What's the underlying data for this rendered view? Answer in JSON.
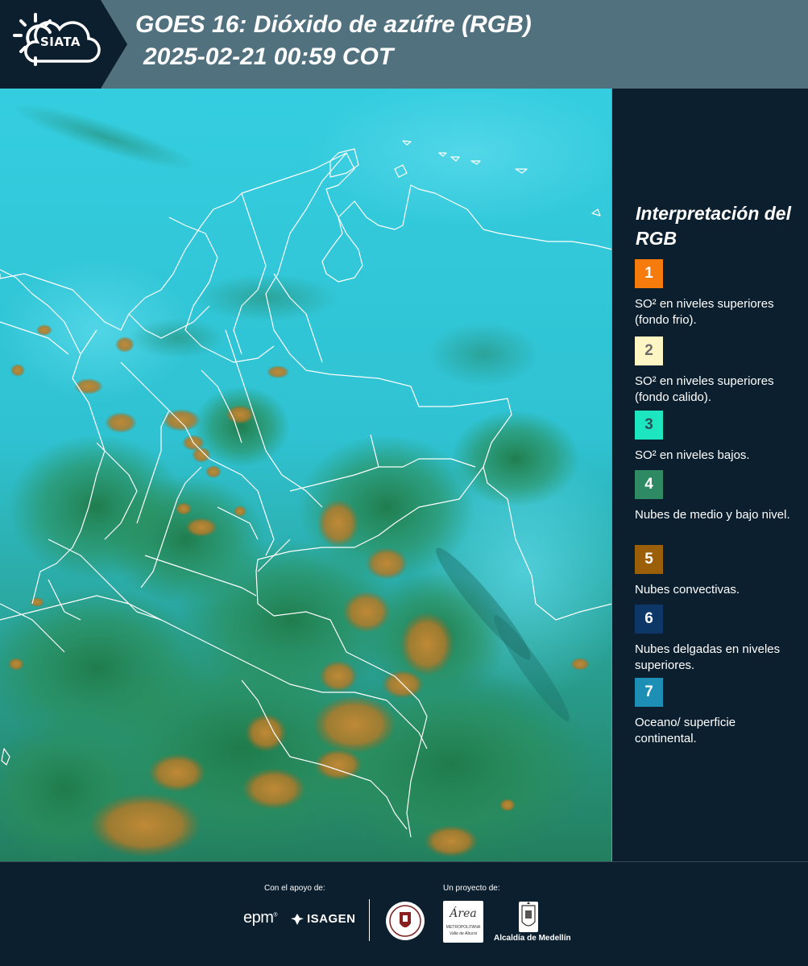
{
  "header": {
    "logo_text": "SIATA",
    "title_line1": "GOES 16: Dióxido de azúfre (RGB)",
    "title_line2": "2025-02-21 00:59 COT"
  },
  "legend": {
    "title": "Interpretación del RGB",
    "items": [
      {
        "number": "1",
        "color": "#f47b0c",
        "number_color": "#ffffff",
        "description": "SO² en niveles superiores (fondo frio)."
      },
      {
        "number": "2",
        "color": "#fdf5c3",
        "number_color": "#6b6b6b",
        "description": "SO² en niveles superiores (fondo calido)."
      },
      {
        "number": "3",
        "color": "#1de5c0",
        "number_color": "#2d4f5a",
        "description": "SO² en niveles bajos."
      },
      {
        "number": "4",
        "color": "#2e8a63",
        "number_color": "#ffffff",
        "description": "Nubes de medio y bajo nivel."
      },
      {
        "number": "5",
        "color": "#9b5f0a",
        "number_color": "#ffffff",
        "description": "Nubes convectivas."
      },
      {
        "number": "6",
        "color": "#0d3766",
        "number_color": "#ffffff",
        "description": "Nubes delgadas en niveles superiores."
      },
      {
        "number": "7",
        "color": "#1d8fb5",
        "number_color": "#ffffff",
        "description": "Oceano/ superficie continental."
      }
    ]
  },
  "footer": {
    "support_label": "Con el apoyo de:",
    "project_label": "Un proyecto de:",
    "epm_text": "epm",
    "isagen_text": "ISAGEN",
    "area_text_main": "Área",
    "area_text_sub": "METROPOLITANA",
    "area_text_sub2": "Valle de Aburrá",
    "medellin_label": "Alcaldía de Medellín"
  },
  "colors": {
    "background": "#0c1f2e",
    "header_bar": "#52717f",
    "map_ocean": "#2ec7d8",
    "map_green": "#2b8e57",
    "map_convective": "#b57d2a"
  }
}
